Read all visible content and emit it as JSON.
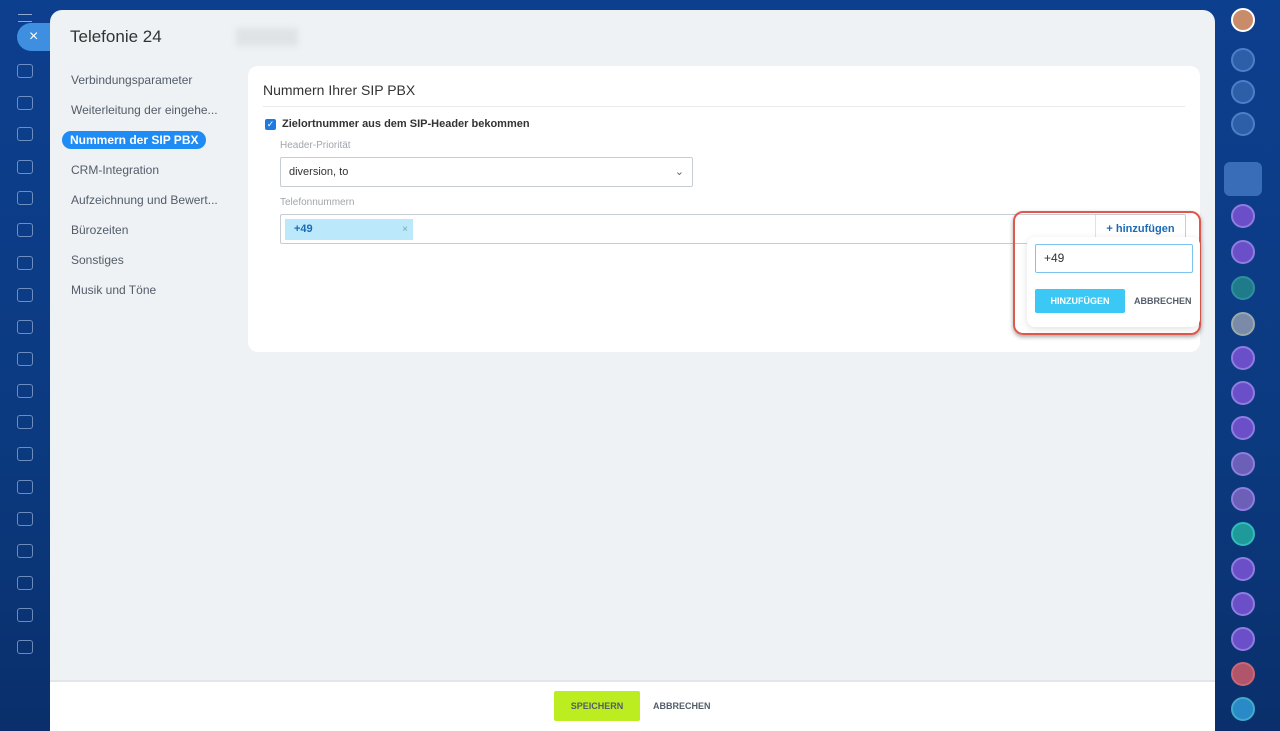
{
  "app": {
    "title": "Telefonie 24",
    "close_icon": "×"
  },
  "nav": {
    "items": [
      {
        "label": "Verbindungsparameter"
      },
      {
        "label": "Weiterleitung der eingehe..."
      },
      {
        "label": "Nummern der SIP PBX"
      },
      {
        "label": "CRM-Integration"
      },
      {
        "label": "Aufzeichnung und Bewert..."
      },
      {
        "label": "Bürozeiten"
      },
      {
        "label": "Sonstiges"
      },
      {
        "label": "Musik und Töne"
      }
    ],
    "active": "Nummern der SIP PBX"
  },
  "card": {
    "title": "Nummern Ihrer SIP PBX",
    "checkbox_label": "Zielortnummer aus dem SIP-Header bekommen",
    "checkbox_checked": true,
    "header_priority_label": "Header-Priorität",
    "header_priority_value": "diversion, to",
    "phone_label": "Telefonnummern",
    "phone_tag": "+49",
    "add_link": "+ hinzufügen"
  },
  "popup": {
    "input_value": "+49",
    "add_button": "HINZUFÜGEN",
    "cancel_button": "ABBRECHEN"
  },
  "footer": {
    "save": "SPEICHERN",
    "cancel": "ABBRECHEN"
  },
  "colors": {
    "accent": "#1f8bf5",
    "highlight": "#e0584d",
    "save": "#bbed21"
  }
}
